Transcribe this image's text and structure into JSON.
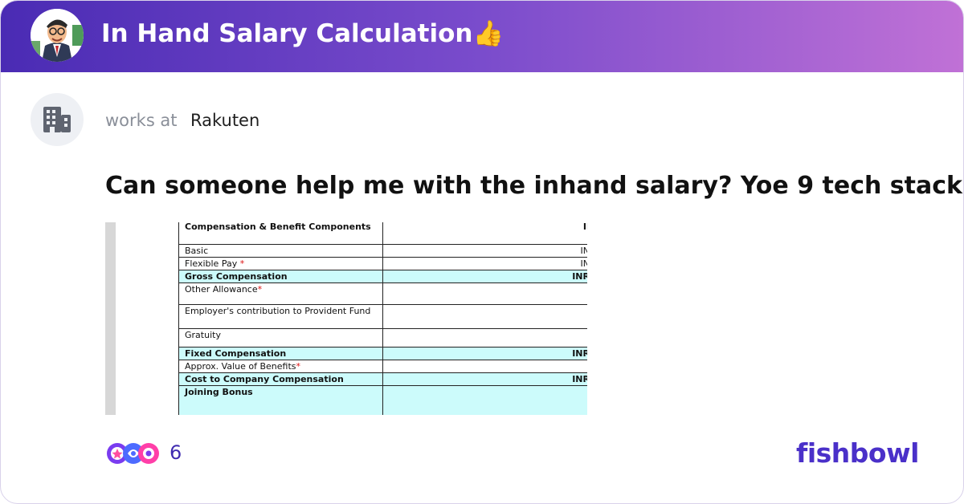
{
  "header": {
    "title": "In Hand Salary Calculation👍"
  },
  "post": {
    "works_at_label": "works at",
    "company": "Rakuten",
    "question": "Can someone help me with the inhand salary? Yoe 9 tech stack..."
  },
  "table": {
    "rows": [
      {
        "label": "Compensation & Benefit Components",
        "value": "II",
        "bold": true,
        "cyan": false
      },
      {
        "label": "Basic",
        "value": "IN",
        "bold": false,
        "cyan": false
      },
      {
        "label": "Flexible Pay *",
        "value": "IN",
        "bold": false,
        "cyan": false
      },
      {
        "label": "Gross Compensation",
        "value": "INR",
        "bold": true,
        "cyan": true
      },
      {
        "label": "Other Allowance*",
        "value": "",
        "bold": false,
        "cyan": false
      },
      {
        "label": "Employer's contribution to Provident Fund",
        "value": "",
        "bold": false,
        "cyan": false
      },
      {
        "label": "Gratuity",
        "value": "",
        "bold": false,
        "cyan": false
      },
      {
        "label": "Fixed Compensation",
        "value": "INR",
        "bold": true,
        "cyan": true
      },
      {
        "label": "Approx. Value of Benefits*",
        "value": "",
        "bold": false,
        "cyan": false
      },
      {
        "label": "Cost to Company Compensation",
        "value": "INR",
        "bold": true,
        "cyan": true
      },
      {
        "label": "Joining Bonus",
        "value": "",
        "bold": true,
        "cyan": true
      }
    ]
  },
  "footer": {
    "reaction_count": "6",
    "brand": "fishbowl"
  },
  "icons": {
    "avatar": "cartoon-businessman-avatar",
    "company": "building-icon",
    "reactions": "reaction-emoji-icons"
  },
  "colors": {
    "header_start": "#4a2bb4",
    "header_end": "#c071d6",
    "brand": "#4a30c9"
  }
}
